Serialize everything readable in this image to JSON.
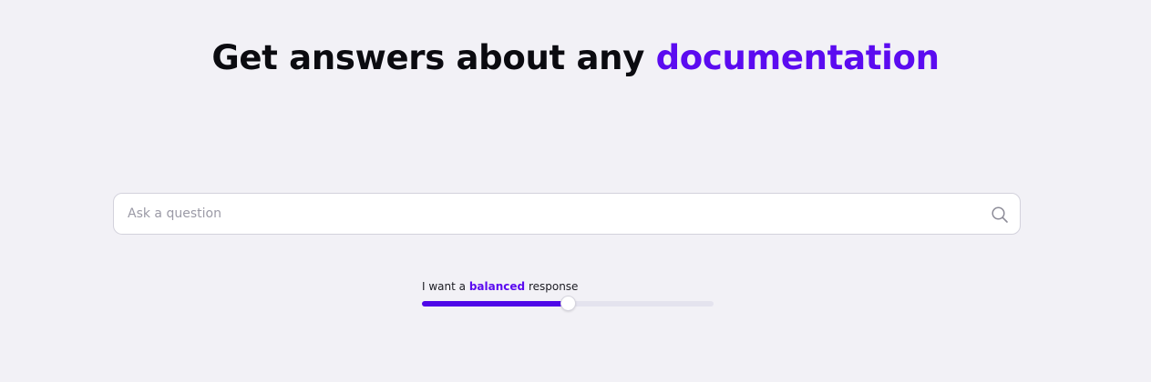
{
  "header": {
    "headline_prefix": "Get answers about any ",
    "headline_accent": "documentation"
  },
  "search": {
    "placeholder": "Ask a question",
    "value": "",
    "icon": "search-icon"
  },
  "response_slider": {
    "label_prefix": "I want a ",
    "label_level": "balanced",
    "label_suffix": " response",
    "value": 0.5
  },
  "colors": {
    "accent": "#5b0bf0",
    "slider_fill": "#4f07e8",
    "slider_track": "#e4e3ee",
    "background": "#f2f1f6"
  }
}
